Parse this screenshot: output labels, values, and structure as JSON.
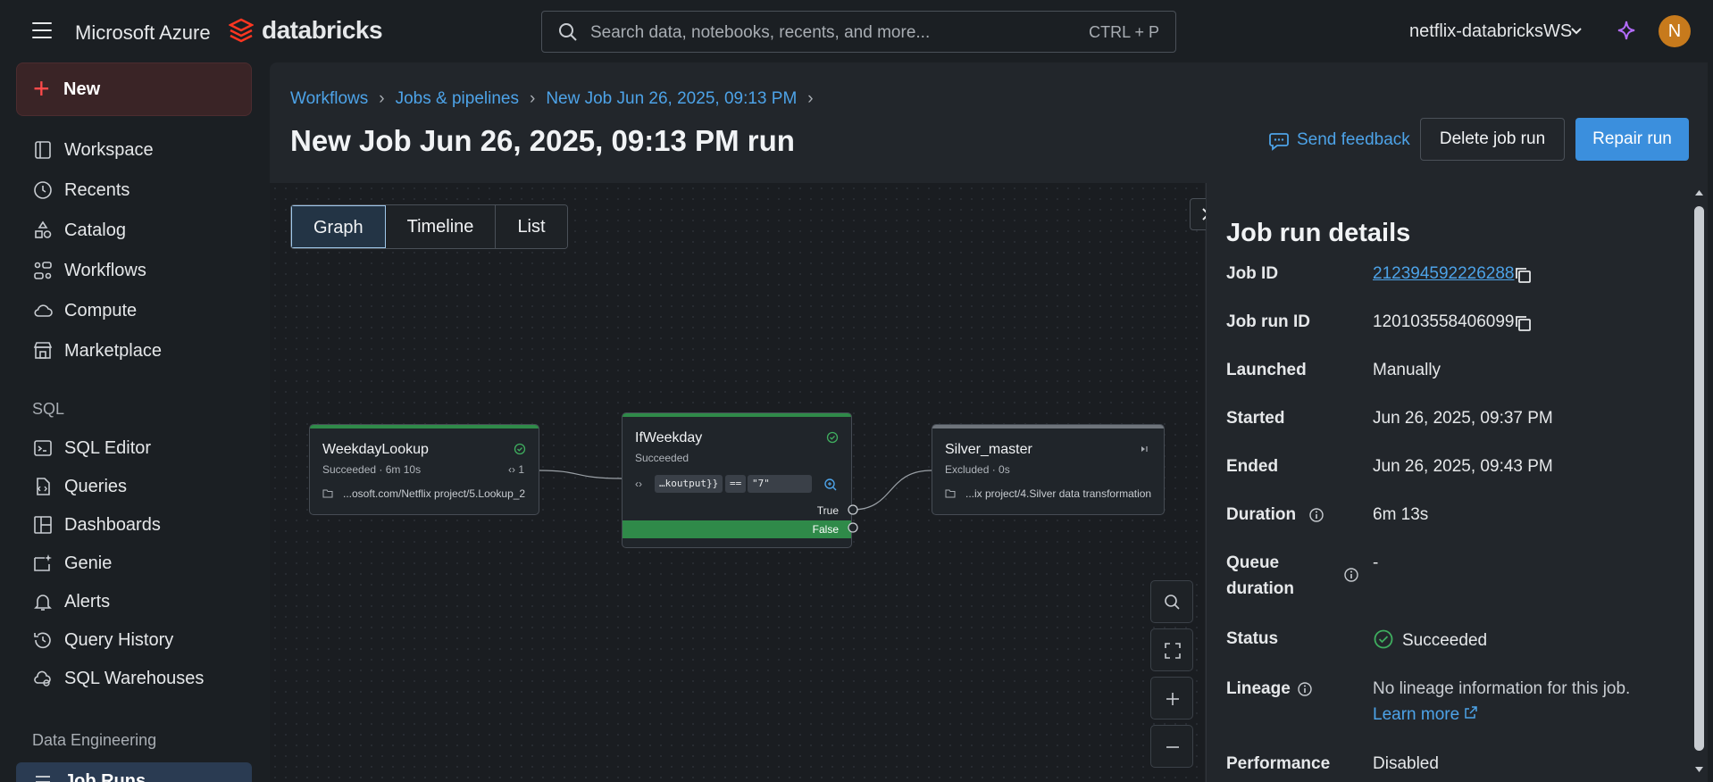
{
  "topbar": {
    "ms_brand": "Microsoft Azure",
    "db_brand": "databricks",
    "search_placeholder": "Search data, notebooks, recents, and more...",
    "search_shortcut": "CTRL + P",
    "workspace": "netflix-databricksWS",
    "avatar_initial": "N"
  },
  "sidebar": {
    "new_label": "New",
    "items": [
      {
        "label": "Workspace",
        "icon": "workspace-icon"
      },
      {
        "label": "Recents",
        "icon": "clock-icon"
      },
      {
        "label": "Catalog",
        "icon": "catalog-icon"
      },
      {
        "label": "Workflows",
        "icon": "workflows-icon"
      },
      {
        "label": "Compute",
        "icon": "cloud-icon"
      },
      {
        "label": "Marketplace",
        "icon": "store-icon"
      }
    ],
    "sql_section": "SQL",
    "sql_items": [
      {
        "label": "SQL Editor",
        "icon": "sql-editor-icon"
      },
      {
        "label": "Queries",
        "icon": "query-icon"
      },
      {
        "label": "Dashboards",
        "icon": "dashboard-icon"
      },
      {
        "label": "Genie",
        "icon": "genie-icon"
      },
      {
        "label": "Alerts",
        "icon": "bell-icon"
      },
      {
        "label": "Query History",
        "icon": "history-icon"
      },
      {
        "label": "SQL Warehouses",
        "icon": "warehouse-icon"
      }
    ],
    "de_section": "Data Engineering",
    "de_items": [
      {
        "label": "Job Runs",
        "icon": "job-runs-icon"
      }
    ]
  },
  "breadcrumb": [
    "Workflows",
    "Jobs & pipelines",
    "New Job Jun 26, 2025, 09:13 PM"
  ],
  "page_title": "New Job Jun 26, 2025, 09:13 PM run",
  "actions": {
    "feedback": "Send feedback",
    "delete": "Delete job run",
    "repair": "Repair run"
  },
  "view_tabs": [
    "Graph",
    "Timeline",
    "List"
  ],
  "active_tab": "Graph",
  "graph": {
    "nodes": [
      {
        "name": "WeekdayLookup",
        "status": "Succeeded",
        "duration": "6m 10s",
        "iterations": "1",
        "path": "...osoft.com/Netflix project/5.Lookup_2"
      },
      {
        "name": "IfWeekday",
        "status": "Succeeded",
        "left_operand": "…koutput}}",
        "operator": "==",
        "right_operand": "\"7\"",
        "true_label": "True",
        "false_label": "False"
      },
      {
        "name": "Silver_master",
        "status": "Excluded",
        "duration": "0s",
        "path": "...ix project/4.Silver data transformation"
      }
    ]
  },
  "details": {
    "title": "Job run details",
    "rows": [
      {
        "key": "Job ID",
        "value": "212394592226288"
      },
      {
        "key": "Job run ID",
        "value": "120103558406099"
      },
      {
        "key": "Launched",
        "value": "Manually"
      },
      {
        "key": "Started",
        "value": "Jun 26, 2025, 09:37 PM"
      },
      {
        "key": "Ended",
        "value": "Jun 26, 2025, 09:43 PM"
      },
      {
        "key": "Duration",
        "value": "6m 13s"
      },
      {
        "key": "Queue",
        "key2": "duration",
        "value": "-"
      },
      {
        "key": "Status",
        "value": "Succeeded"
      },
      {
        "key": "Lineage",
        "value": "No lineage information for this job.",
        "link": "Learn more"
      },
      {
        "key": "Performance",
        "value": "Disabled"
      }
    ]
  },
  "colors": {
    "accent": "#3b8fdd",
    "link": "#4da3e8",
    "success": "#2f8a49",
    "brand_red": "#ff4a4a"
  }
}
